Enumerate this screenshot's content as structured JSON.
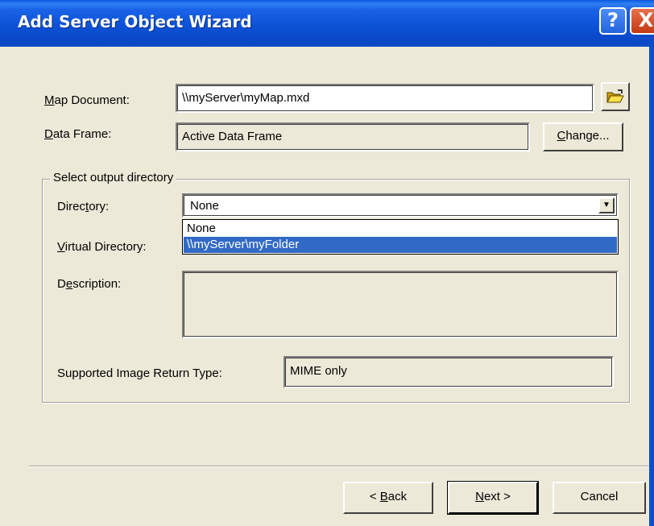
{
  "window": {
    "title": "Add Server Object Wizard"
  },
  "title_buttons": {
    "help": "?",
    "close": "X"
  },
  "map_document": {
    "label_u": "M",
    "label_rest": "ap Document:",
    "value": "\\\\myServer\\myMap.mxd"
  },
  "data_frame": {
    "label_u": "D",
    "label_rest": "ata Frame:",
    "value": "Active Data Frame",
    "button_u": "C",
    "button_rest": "hange..."
  },
  "group": {
    "title": "Select output directory"
  },
  "directory": {
    "label_pre": "Direc",
    "label_u": "t",
    "label_post": "ory:",
    "value": "None",
    "options": [
      "None",
      "\\\\myServer\\myFolder"
    ]
  },
  "virtual_directory": {
    "label_u": "V",
    "label_rest": "irtual Directory:"
  },
  "description": {
    "label_pre": "D",
    "label_u": "e",
    "label_post": "scription:"
  },
  "image_return": {
    "label": "Supported Image Return Type:",
    "value": "MIME only"
  },
  "buttons": {
    "back_pre": "< ",
    "back_u": "B",
    "back_rest": "ack",
    "next_u": "N",
    "next_rest": "ext >",
    "cancel": "Cancel"
  }
}
